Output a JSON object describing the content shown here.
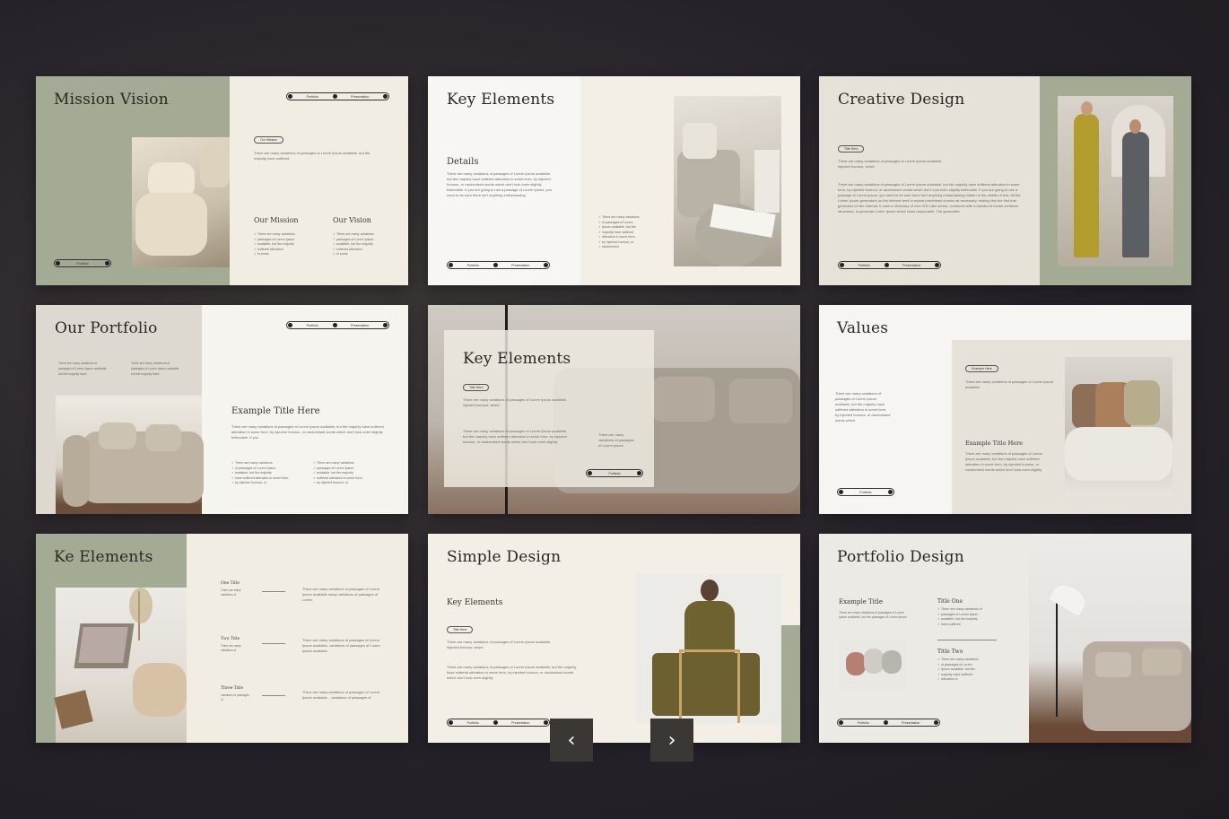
{
  "slides": [
    {
      "title": "Mission Vision",
      "nav": [
        "Portfolio",
        "Presentation"
      ],
      "badge": "Our Mission",
      "intro": "There are many variations of passages of Lorem Ipsum available, but the majority have suffered",
      "col1_title": "Our Mission",
      "col2_title": "Our Vision",
      "list": [
        "There are many variations",
        "passages of Lorem Ipsum",
        "available, but the majority",
        "suffered alteration",
        "in some"
      ],
      "footer": "Portfolio"
    },
    {
      "title": "Key Elements",
      "subtitle": "Details",
      "body": "There are many variations of passages of Lorem Ipsum available, but the majority have suffered alteration in some form, by injected humour, or randomised words which don't look even slightly believable. If you are going to use a passage of Lorem Ipsum, you need to be sure there isn't anything embarrassing",
      "numbered": [
        "There are many variations",
        "of passages of Lorem",
        "Ipsum available, but the",
        "majority have suffered",
        "alteration in some form,",
        "by injected humour, or",
        "randomised"
      ],
      "nav": [
        "Portfolio",
        "Presentation"
      ]
    },
    {
      "title": "Creative Design",
      "badge": "Title Here",
      "intro": "There are many variations of passages of Lorem Ipsum available, injected humour, which",
      "body": "There are many variations of passages of Lorem Ipsum available, but the majority have suffered alteration in some form, by injected humour, or randomised words which don't look even slightly believable. If you are going to use a passage of Lorem Ipsum, you need to be sure there isn't anything embarrassing hidden in the middle of text. All the Lorem Ipsum generators on the Internet tend to repeat predefined chunks as necessary, making this the first true generator on the Internet. It uses a dictionary of over 200 Latin words, combined with a handful of model sentence structures, to generate Lorem Ipsum which looks reasonable. The generated",
      "nav": [
        "Portfolio",
        "Presentation"
      ]
    },
    {
      "title": "Our Portfolio",
      "nav": [
        "Portfolio",
        "Presentation"
      ],
      "mini1": "There are many variations of passages of Lorem Ipsum available, but the majority have",
      "mini2": "There are many variations of passages of Lorem Ipsum available, but the majority have",
      "subtitle": "Example Title Here",
      "body": "There are many variations of passages of Lorem Ipsum available, but the majority have suffered alteration in some form, by injected humour, or randomised words which don't look even slightly believable. If you",
      "list1": [
        "There are many variations",
        "of passages of Lorem Ipsum",
        "available, but the majority",
        "have suffered alteration in some form,",
        "by injected humour, or"
      ],
      "list2": [
        "There are many variations",
        "passages of Lorem Ipsum",
        "available, but the majority",
        "suffered alteration in some form,",
        "by injected humour, or"
      ]
    },
    {
      "title": "Key Elements",
      "badge": "Title Here",
      "intro": "There are many variations of passages of Lorem Ipsum available, injected humour, which",
      "body": "There are many variations of passages of Lorem Ipsum available, but the majority have suffered alteration in some form, by injected humour, or randomised words which don't look even slightly",
      "side": "There are many variations of passages of Lorem Ipsum",
      "nav": "Portfolio"
    },
    {
      "title": "Values",
      "left": "There are many variations of passages of Lorem Ipsum available, but the majority have suffered alteration in some form, by injected humour, or randomised words which",
      "badge": "Example Here",
      "intro": "There are many variations of passages of Lorem Ipsum available.",
      "subtitle": "Example Title Here",
      "body": "There are many variations of passages of Lorem Ipsum available, but the majority have suffered alteration in some form, by injected humour, or randomised words which don't look even slightly",
      "nav": "Portfolio"
    },
    {
      "title": "Ke Elements",
      "items": [
        {
          "title": "One Title",
          "sub": "There are many variations of",
          "body": "There are many variations of passages of Lorem Ipsum available many variations of passages of Lorem"
        },
        {
          "title": "Two Title",
          "sub": "There are many variations of",
          "body": "There are many variations of passages of Lorem Ipsum available, variations of passages of Lorem Ipsum available"
        },
        {
          "title": "Three Title",
          "sub": "variations of passages of",
          "body": "There are many variations of passages of Lorem Ipsum available, , variations of passages of"
        }
      ]
    },
    {
      "title": "Simple Design",
      "subtitle": "Key Elements",
      "badge": "Title Here",
      "intro": "There are many variations of passages of Lorem Ipsum available, injected humour, which",
      "body": "There are many variations of passages of Lorem Ipsum available, but the majority have suffered alteration in some form, by injected humour, or randomised words which don't look even slightly",
      "nav": [
        "Portfolio",
        "Presentation"
      ]
    },
    {
      "title": "Portfolio Design",
      "subtitle": "Example Title",
      "intro": "There are many variations of passages of Lorem Ipsum available, but the passages of Lorem Ipsum",
      "t1": "Title One",
      "list1": [
        "There are many variations of",
        "passages of Lorem Ipsum",
        "available, but the majority",
        "have suffered"
      ],
      "t2": "Title Two",
      "list2": [
        "There are many variations",
        "of passages of Lorem",
        "Ipsum available, but the",
        "majority have suffered",
        "alteration in"
      ],
      "nav": [
        "Portfolio",
        "Presentation"
      ]
    }
  ],
  "controls": {
    "prev": "‹",
    "next": "›"
  }
}
